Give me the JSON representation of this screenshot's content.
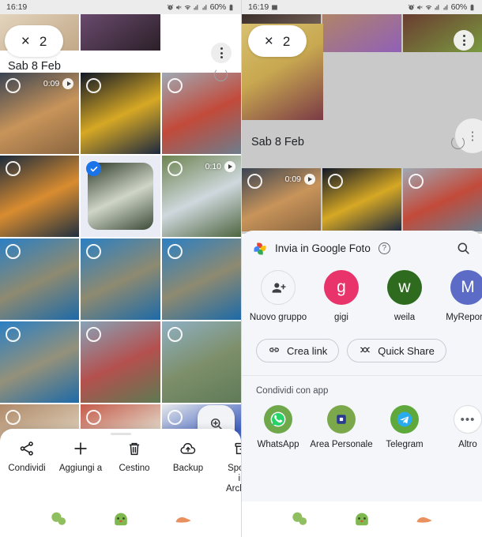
{
  "statusbar": {
    "time": "16:19",
    "battery": "60%",
    "icons": [
      "image-icon",
      "alarm-icon",
      "mute-icon",
      "wifi-icon",
      "signal-icon",
      "signal-icon",
      "battery-icon"
    ]
  },
  "left_panel": {
    "selection": {
      "close_label": "×",
      "count": "2"
    },
    "date_header": "Sab 8 Feb",
    "grid": [
      {
        "kind": "video",
        "duration": "0:09",
        "selected": false,
        "c1": "#3a4352",
        "c2": "#c8945a",
        "c3": "#8a6640"
      },
      {
        "kind": "photo",
        "duration": "",
        "selected": false,
        "c1": "#101626",
        "c2": "#d6a824",
        "c3": "#1c2840"
      },
      {
        "kind": "photo",
        "duration": "",
        "selected": false,
        "c1": "#9fa9b4",
        "c2": "#c24a3a",
        "c3": "#6d7d8c"
      },
      {
        "kind": "photo",
        "duration": "",
        "selected": false,
        "c1": "#1b2a3c",
        "c2": "#d98c30",
        "c3": "#20303f"
      },
      {
        "kind": "photo",
        "duration": "",
        "selected": true,
        "c1": "#2f3a2a",
        "c2": "#cfd6c8",
        "c3": "#3d4a38"
      },
      {
        "kind": "video",
        "duration": "0:10",
        "selected": false,
        "c1": "#6c8350",
        "c2": "#cfd8dd",
        "c3": "#4e6540"
      },
      {
        "kind": "photo",
        "duration": "",
        "selected": false,
        "c1": "#2a7fc4",
        "c2": "#8e8a70",
        "c3": "#1d6aa8"
      },
      {
        "kind": "photo",
        "duration": "",
        "selected": false,
        "c1": "#2a7fc4",
        "c2": "#8e8a70",
        "c3": "#1d6aa8"
      },
      {
        "kind": "photo",
        "duration": "",
        "selected": false,
        "c1": "#2a7fc4",
        "c2": "#8e8a70",
        "c3": "#1d6aa8"
      },
      {
        "kind": "photo",
        "duration": "",
        "selected": false,
        "c1": "#2a7fc4",
        "c2": "#94917a",
        "c3": "#1d6aa8"
      },
      {
        "kind": "photo",
        "duration": "",
        "selected": false,
        "c1": "#87a3b8",
        "c2": "#b4504e",
        "c3": "#5d7a52"
      },
      {
        "kind": "photo",
        "duration": "",
        "selected": false,
        "c1": "#8fb0c4",
        "c2": "#7d8f6a",
        "c3": "#5f7a58"
      },
      {
        "kind": "photo",
        "duration": "",
        "selected": false,
        "c1": "#b08a6a",
        "c2": "#d8c8b0",
        "c3": "#8d6f52"
      },
      {
        "kind": "photo",
        "duration": "",
        "selected": false,
        "c1": "#c65a4a",
        "c2": "#e0d4c4",
        "c3": "#a04438"
      },
      {
        "kind": "photo",
        "duration": "",
        "selected": false,
        "c1": "#e6e8ea",
        "c2": "#3f5fbf",
        "c3": "#c8ccd0"
      }
    ],
    "fab": {
      "name": "zoom-in-fab"
    },
    "actions": [
      {
        "label": "Condividi",
        "icon": "share-icon"
      },
      {
        "label": "Aggiungi a",
        "icon": "plus-icon"
      },
      {
        "label": "Cestino",
        "icon": "trash-icon"
      },
      {
        "label": "Backup",
        "icon": "cloud-upload-icon"
      },
      {
        "label": "Sposta in Archivio",
        "icon": "archive-icon"
      }
    ]
  },
  "right_panel": {
    "selection": {
      "close_label": "×",
      "count": "2"
    },
    "date_header": "Sab 8 Feb",
    "strip_top": [
      {
        "c1": "#3b2f2b",
        "c2": "#8a7468"
      },
      {
        "c1": "#b08468",
        "c2": "#9060b8"
      },
      {
        "c1": "#6a3c30",
        "c2": "#7a9a40"
      }
    ],
    "big_tile": {
      "c1": "#d8c070",
      "c2": "#7a3a46",
      "c3": "#c8a850"
    },
    "strip_second": [
      {
        "kind": "video",
        "duration": "0:09",
        "c1": "#3a4352",
        "c2": "#c8945a",
        "c3": "#8a6640"
      },
      {
        "kind": "photo",
        "duration": "",
        "c1": "#101626",
        "c2": "#d6a824",
        "c3": "#1c2840"
      },
      {
        "kind": "photo",
        "duration": "",
        "c1": "#9fa9b4",
        "c2": "#c24a3a",
        "c3": "#6d7d8c"
      }
    ],
    "share_sheet": {
      "title": "Invia in Google Foto",
      "help_label": "?",
      "search_icon": "search-icon",
      "contacts": [
        {
          "name": "Nuovo gruppo",
          "initial": "",
          "color": "#f4f6fa",
          "type": "new-group"
        },
        {
          "name": "gigi",
          "initial": "g",
          "color": "#E8336B",
          "type": "contact"
        },
        {
          "name": "weila",
          "initial": "w",
          "color": "#2E6B1F",
          "type": "contact"
        },
        {
          "name": "MyReports",
          "initial": "M",
          "color": "#5B6BC6",
          "type": "contact"
        }
      ],
      "quick_buttons": [
        {
          "label": "Crea link",
          "icon": "link-icon"
        },
        {
          "label": "Quick Share",
          "icon": "quick-share-icon"
        }
      ],
      "apps_section_title": "Condividi con app",
      "apps": [
        {
          "label": "WhatsApp",
          "icon": "whatsapp-icon",
          "color": "#6FA84B"
        },
        {
          "label": "Area Personale",
          "icon": "folder-secure-icon",
          "color": "#7BA84B"
        },
        {
          "label": "Telegram",
          "icon": "telegram-icon",
          "color": "#5FA83B"
        },
        {
          "label": "Altro",
          "icon": "more-icon",
          "color": "#ffffff"
        }
      ]
    }
  },
  "navbar": {
    "items": [
      {
        "name": "recents-blob",
        "color": "#8fbf5f"
      },
      {
        "name": "home-blob",
        "color": "#7fb84f"
      },
      {
        "name": "back-blob",
        "color": "#e8915f"
      }
    ]
  },
  "theme": {
    "accent": "#1a73e8",
    "sheet_bg": "#f4f6fa",
    "status_bg": "#ececec",
    "dim_bg": "#c9c9c9"
  }
}
